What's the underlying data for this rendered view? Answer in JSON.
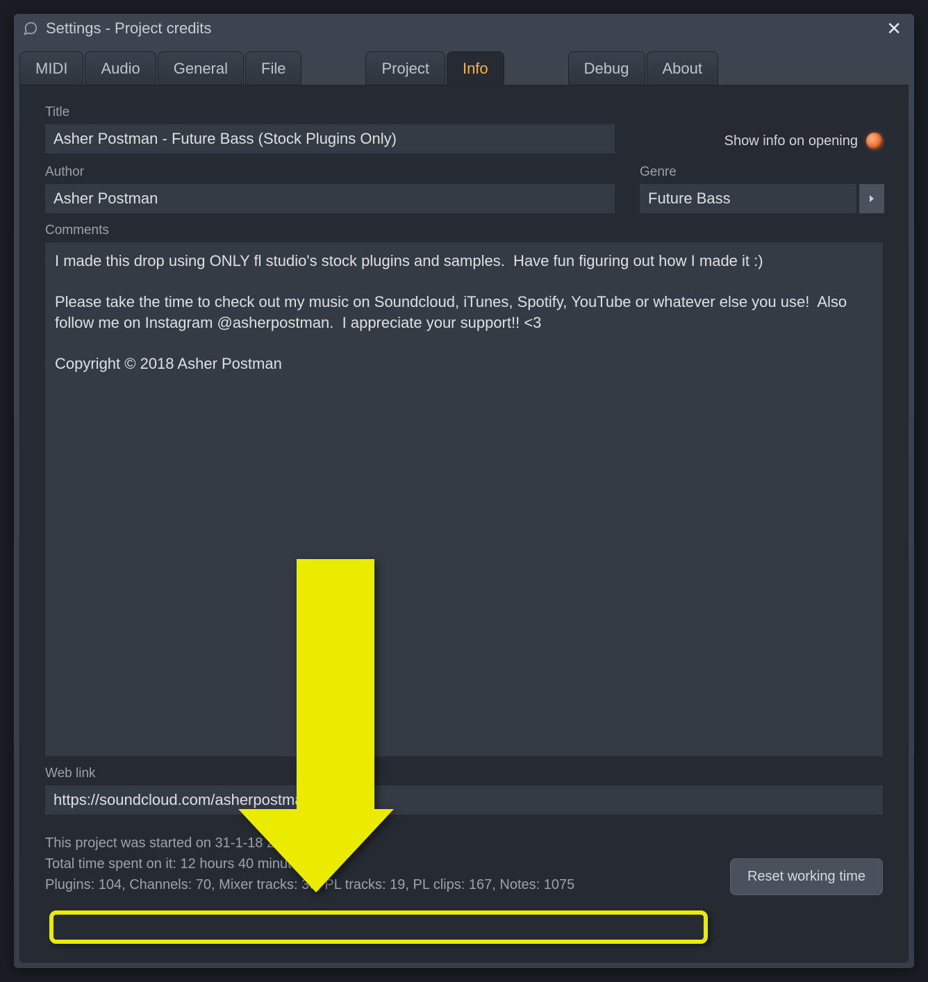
{
  "window": {
    "title": "Settings - Project credits"
  },
  "tabs": {
    "midi": "MIDI",
    "audio": "Audio",
    "general": "General",
    "file": "File",
    "project": "Project",
    "info": "Info",
    "debug": "Debug",
    "about": "About",
    "active": "info"
  },
  "fields": {
    "title_label": "Title",
    "title_value": "Asher Postman - Future Bass (Stock Plugins Only)",
    "show_info_label": "Show info on opening",
    "author_label": "Author",
    "author_value": "Asher Postman",
    "genre_label": "Genre",
    "genre_value": "Future Bass",
    "comments_label": "Comments",
    "comments_value": "I made this drop using ONLY fl studio's stock plugins and samples.  Have fun figuring out how I made it :)\n\nPlease take the time to check out my music on Soundcloud, iTunes, Spotify, YouTube or whatever else you use!  Also follow me on Instagram @asherpostman.  I appreciate your support!! <3\n\nCopyright © 2018 Asher Postman",
    "weblink_label": "Web link",
    "weblink_value": "https://soundcloud.com/asherpostman"
  },
  "footer": {
    "started_line": "This project was started on 31-1-18 21:15.",
    "time_line": "Total time spent on it: 12 hours 40 minutes",
    "stats_line": "Plugins: 104, Channels: 70, Mixer tracks: 39, PL tracks: 19, PL clips: 167, Notes: 1075",
    "reset_label": "Reset working time"
  }
}
